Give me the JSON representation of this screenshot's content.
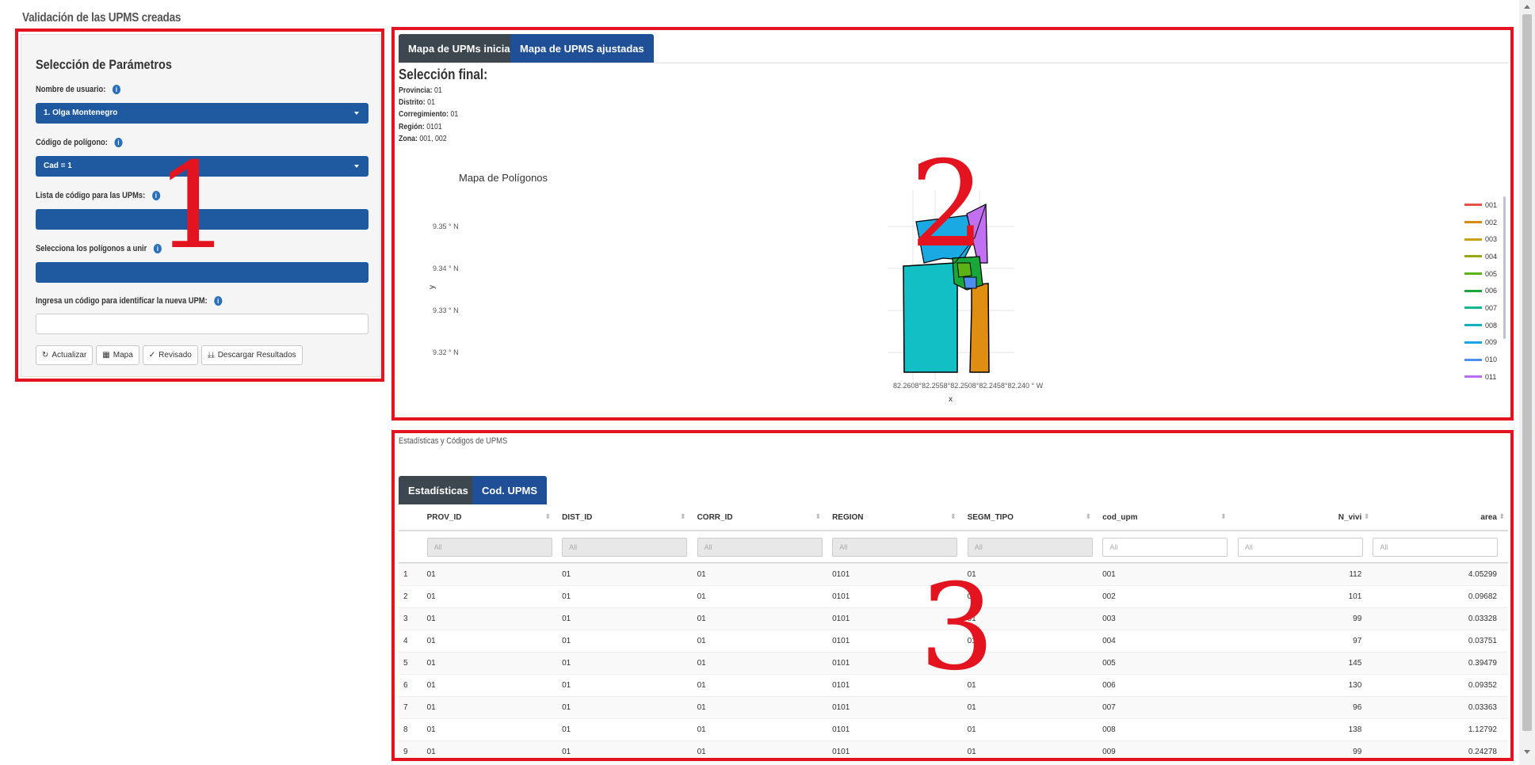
{
  "app": {
    "title": "Validación de las UPMS creadas"
  },
  "params": {
    "heading": "Selección de Parámetros",
    "user_label": "Nombre de usuario:",
    "user_value": "1. Olga Montenegro",
    "polygon_label": "Código de polígono:",
    "polygon_value": "Cad = 1",
    "upm_codes_label": "Lista de código para las UPMs:",
    "merge_label": "Selecciona los polígonos a unir",
    "new_code_label": "Ingresa un código para identificar la nueva UPM:",
    "buttons": {
      "update": "Actualizar",
      "map": "Mapa",
      "reviewed": "Revisado",
      "download": "Descargar Resultados"
    }
  },
  "map_panel": {
    "tabs": [
      "Mapa de UPMs inicial",
      "Mapa de UPMS ajustadas"
    ],
    "selection_title": "Selección final:",
    "selection": [
      {
        "key": "Provincia:",
        "value": " 01"
      },
      {
        "key": "Distrito:",
        "value": " 01"
      },
      {
        "key": "Corregimiento:",
        "value": " 01"
      },
      {
        "key": "Región:",
        "value": " 0101"
      },
      {
        "key": "Zona:",
        "value": " 001, 002"
      }
    ],
    "map": {
      "title": "Mapa de Polígonos",
      "y_ticks": [
        "9.35 ° N",
        "9.34 ° N",
        "9.33 ° N",
        "9.32 ° N"
      ],
      "y_label": "y",
      "x_ticks": "82.2608°82.2558°82.2508°82.2458°82.240 ° W",
      "x_label": "x",
      "legend": [
        {
          "label": "001",
          "color": "#e8504a"
        },
        {
          "label": "002",
          "color": "#d98a10"
        },
        {
          "label": "003",
          "color": "#c9a20c"
        },
        {
          "label": "004",
          "color": "#9aa60d"
        },
        {
          "label": "005",
          "color": "#5db315"
        },
        {
          "label": "006",
          "color": "#1aa73a"
        },
        {
          "label": "007",
          "color": "#11b590"
        },
        {
          "label": "008",
          "color": "#13b1c0"
        },
        {
          "label": "009",
          "color": "#1ba4e3"
        },
        {
          "label": "010",
          "color": "#4d8ef0"
        },
        {
          "label": "011",
          "color": "#b56ef0"
        }
      ]
    }
  },
  "stats": {
    "heading": "Estadísticas y Códigos de UPMS",
    "tabs": [
      "Estadísticas",
      "Cod. UPMS"
    ],
    "columns": [
      "PROV_ID",
      "DIST_ID",
      "CORR_ID",
      "REGION",
      "SEGM_TIPO",
      "cod_upm",
      "N_vivi",
      "area"
    ],
    "filter_placeholder": "All",
    "rows": [
      [
        "1",
        "01",
        "01",
        "01",
        "0101",
        "01",
        "001",
        "112",
        "4.05299"
      ],
      [
        "2",
        "01",
        "01",
        "01",
        "0101",
        "01",
        "002",
        "101",
        "0.09682"
      ],
      [
        "3",
        "01",
        "01",
        "01",
        "0101",
        "01",
        "003",
        "99",
        "0.03328"
      ],
      [
        "4",
        "01",
        "01",
        "01",
        "0101",
        "01",
        "004",
        "97",
        "0.03751"
      ],
      [
        "5",
        "01",
        "01",
        "01",
        "0101",
        "01",
        "005",
        "145",
        "0.39479"
      ],
      [
        "6",
        "01",
        "01",
        "01",
        "0101",
        "01",
        "006",
        "130",
        "0.09352"
      ],
      [
        "7",
        "01",
        "01",
        "01",
        "0101",
        "01",
        "007",
        "96",
        "0.03363"
      ],
      [
        "8",
        "01",
        "01",
        "01",
        "0101",
        "01",
        "008",
        "138",
        "1.12792"
      ],
      [
        "9",
        "01",
        "01",
        "01",
        "0101",
        "01",
        "009",
        "99",
        "0.24278"
      ]
    ]
  },
  "annotations": [
    "1",
    "2",
    "3"
  ]
}
